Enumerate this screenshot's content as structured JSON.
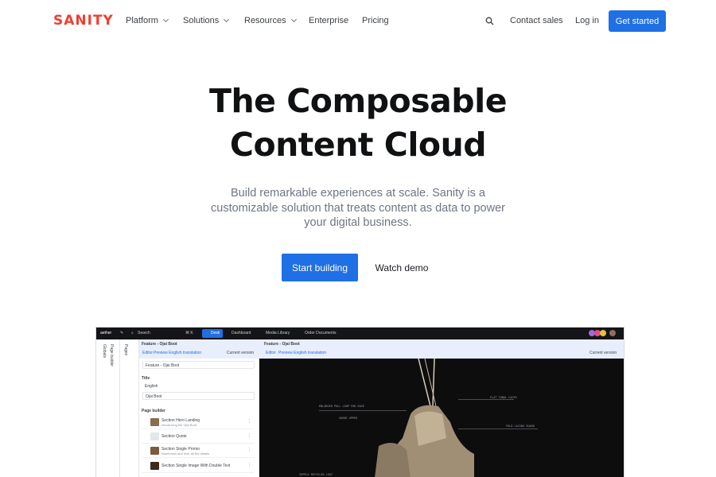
{
  "brand": {
    "logo": "SANITY",
    "accent": "#f03e2f",
    "primary": "#1f6fe5"
  },
  "nav": {
    "items": [
      {
        "label": "Platform",
        "has_dropdown": true
      },
      {
        "label": "Solutions",
        "has_dropdown": true
      },
      {
        "label": "Resources",
        "has_dropdown": true
      },
      {
        "label": "Enterprise",
        "has_dropdown": false
      },
      {
        "label": "Pricing",
        "has_dropdown": false
      }
    ],
    "search_icon": "search-icon",
    "contact": "Contact sales",
    "login": "Log in",
    "cta": "Get started"
  },
  "hero": {
    "title_line1": "The Composable",
    "title_line2": "Content Cloud",
    "subtitle": "Build remarkable experiences at scale. Sanity is a customizable solution that treats content as data to power your digital business.",
    "primary_button": "Start building",
    "secondary_button": "Watch demo"
  },
  "studio": {
    "topbar": {
      "project": "aether",
      "search": "Search",
      "shortcut": "⌘ K",
      "tabs": [
        "Desk",
        "Dashboard",
        "Media Library",
        "Order Documents"
      ]
    },
    "rail": [
      "Globals",
      "Page builder",
      "Pages"
    ],
    "pane1": {
      "title": "Feature - Ojai Boot",
      "tab_editor": "Editor",
      "tab_preview": "Preview English translation",
      "version": "Current version",
      "name_value": "Feature - Ojai Boot",
      "title_label": "Title",
      "lang_label": "English",
      "title_value": "Ojai Boot",
      "builder_label": "Page builder",
      "sections": [
        {
          "title": "Section Hero Landing",
          "subtitle": "Introducing the Ojai Boot"
        },
        {
          "title": "Section Quote",
          "subtitle": ""
        },
        {
          "title": "Section Single Promo",
          "subtitle": "Warmness and ever all the details"
        },
        {
          "title": "Section Single Image With Double Text",
          "subtitle": ""
        }
      ]
    },
    "pane2": {
      "title": "Feature - Ojai Boot",
      "tab_editor": "Editor",
      "tab_preview": "Preview English translation",
      "version": "Current version",
      "annotations": [
        "FLAT TONAL LACES",
        "ENLARGED PULL LOOP FOR EASE",
        "SUEDE UPPER",
        "FOLD LACING GUARD",
        "SUPPLE RECYCLED LEAT"
      ]
    }
  }
}
